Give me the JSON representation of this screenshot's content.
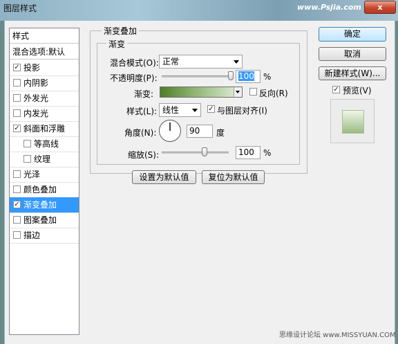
{
  "window": {
    "title": "图层样式",
    "watermark": "www.Psjia.com",
    "close_label": "x"
  },
  "left_panel": {
    "header": "样式",
    "blend_options": "混合选项:默认",
    "items": [
      {
        "label": "投影",
        "checked": true,
        "indent": false,
        "selected": false
      },
      {
        "label": "内阴影",
        "checked": false,
        "indent": false,
        "selected": false
      },
      {
        "label": "外发光",
        "checked": false,
        "indent": false,
        "selected": false
      },
      {
        "label": "内发光",
        "checked": false,
        "indent": false,
        "selected": false
      },
      {
        "label": "斜面和浮雕",
        "checked": true,
        "indent": false,
        "selected": false
      },
      {
        "label": "等高线",
        "checked": false,
        "indent": true,
        "selected": false
      },
      {
        "label": "纹理",
        "checked": false,
        "indent": true,
        "selected": false
      },
      {
        "label": "光泽",
        "checked": false,
        "indent": false,
        "selected": false
      },
      {
        "label": "颜色叠加",
        "checked": false,
        "indent": false,
        "selected": false
      },
      {
        "label": "渐变叠加",
        "checked": true,
        "indent": false,
        "selected": true
      },
      {
        "label": "图案叠加",
        "checked": false,
        "indent": false,
        "selected": false
      },
      {
        "label": "描边",
        "checked": false,
        "indent": false,
        "selected": false
      }
    ]
  },
  "panel": {
    "title": "渐变叠加",
    "group_title": "渐变",
    "blend_mode_label": "混合模式(O):",
    "blend_mode_value": "正常",
    "opacity_label": "不透明度(P):",
    "opacity_value": "100",
    "opacity_unit": "%",
    "opacity_level": 1.0,
    "gradient_label": "渐变:",
    "gradient_colors": [
      "#4f7d2a",
      "#8db370",
      "#d6e6cd"
    ],
    "reverse_label": "反向(R)",
    "reverse_checked": false,
    "style_label": "样式(L):",
    "style_value": "线性",
    "align_label": "与图层对齐(I)",
    "align_checked": true,
    "angle_label": "角度(N):",
    "angle_value": "90",
    "angle_unit": "度",
    "scale_label": "缩放(S):",
    "scale_value": "100",
    "scale_unit": "%",
    "scale_level": 1.0,
    "set_default_label": "设置为默认值",
    "reset_default_label": "复位为默认值"
  },
  "right_buttons": {
    "ok_label": "确定",
    "cancel_label": "取消",
    "new_style_label": "新建样式(W)...",
    "preview_label": "预览(V)",
    "preview_checked": true
  },
  "footer_watermark": "思缘设计论坛 www.MISSYUAN.COM",
  "icons": {
    "checked": "checkmark-icon",
    "dropdown": "chevron-down-icon",
    "close": "close-icon"
  }
}
